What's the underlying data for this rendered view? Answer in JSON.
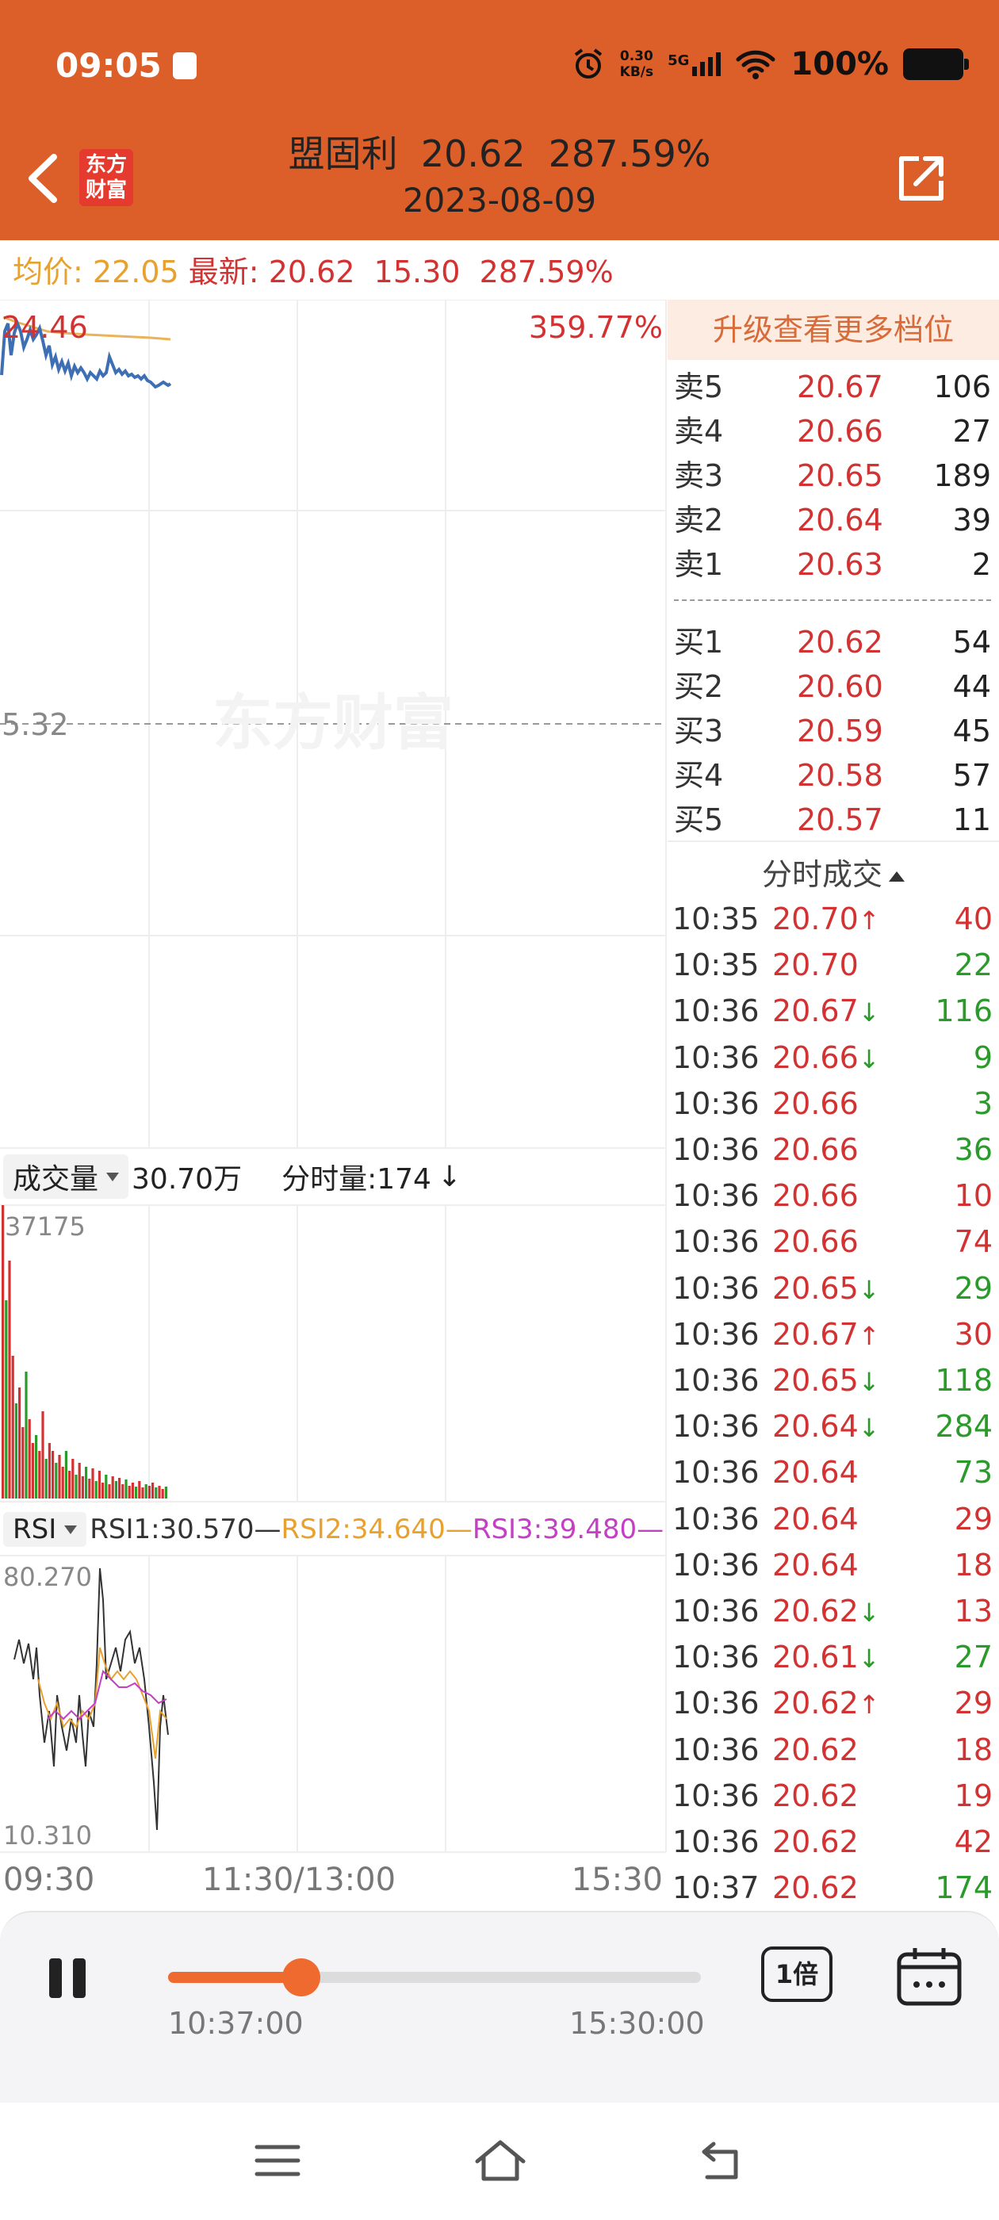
{
  "status_bar": {
    "time": "09:05",
    "net_speed_top": "0.30",
    "net_speed_bottom": "KB/s",
    "network": "5G",
    "battery": "100%"
  },
  "header": {
    "logo_line1": "东方",
    "logo_line2": "财富",
    "stock_name": "盟固利",
    "price": "20.62",
    "change_pct": "287.59%",
    "date": "2023-08-09"
  },
  "info_strip": {
    "avg_label": "均价:",
    "avg_value": "22.05",
    "latest_label": "最新:",
    "latest_value": "20.62",
    "change_value": "15.30",
    "change_pct": "287.59%"
  },
  "price_chart": {
    "top_price_label": "24.46",
    "top_pct_label": "359.77%",
    "mid_price_label": "5.32",
    "watermark": "东方财富"
  },
  "volume_panel": {
    "dropdown_label": "成交量",
    "total": "30.70万",
    "tick_label": "分时量:174",
    "tick_arrow": "↓",
    "max_label": "37175"
  },
  "rsi_panel": {
    "dropdown_label": "RSI",
    "rsi1": "RSI1:30.570—",
    "rsi2": "RSI2:34.640—",
    "rsi3": "RSI3:39.480—",
    "max_label": "80.270",
    "min_label": "10.310",
    "colors": {
      "rsi1": "#333333",
      "rsi2": "#e8a12e",
      "rsi3": "#c43fc4"
    }
  },
  "time_axis": {
    "start": "09:30",
    "mid": "11:30/13:00",
    "end": "15:30"
  },
  "order_book": {
    "upgrade_label": "升级查看更多档位",
    "asks": [
      {
        "label": "卖5",
        "price": "20.67",
        "qty": "106"
      },
      {
        "label": "卖4",
        "price": "20.66",
        "qty": "27"
      },
      {
        "label": "卖3",
        "price": "20.65",
        "qty": "189"
      },
      {
        "label": "卖2",
        "price": "20.64",
        "qty": "39"
      },
      {
        "label": "卖1",
        "price": "20.63",
        "qty": "2"
      }
    ],
    "bids": [
      {
        "label": "买1",
        "price": "20.62",
        "qty": "54"
      },
      {
        "label": "买2",
        "price": "20.60",
        "qty": "44"
      },
      {
        "label": "买3",
        "price": "20.59",
        "qty": "45"
      },
      {
        "label": "买4",
        "price": "20.58",
        "qty": "57"
      },
      {
        "label": "买5",
        "price": "20.57",
        "qty": "11"
      }
    ]
  },
  "ticks": {
    "title": "分时成交",
    "rows": [
      {
        "time": "10:35",
        "price": "20.70",
        "dir": "↑",
        "vol": "40",
        "vol_color": "red"
      },
      {
        "time": "10:35",
        "price": "20.70",
        "dir": "",
        "vol": "22",
        "vol_color": "green"
      },
      {
        "time": "10:36",
        "price": "20.67",
        "dir": "↓",
        "vol": "116",
        "vol_color": "green"
      },
      {
        "time": "10:36",
        "price": "20.66",
        "dir": "↓",
        "vol": "9",
        "vol_color": "green"
      },
      {
        "time": "10:36",
        "price": "20.66",
        "dir": "",
        "vol": "3",
        "vol_color": "green"
      },
      {
        "time": "10:36",
        "price": "20.66",
        "dir": "",
        "vol": "36",
        "vol_color": "green"
      },
      {
        "time": "10:36",
        "price": "20.66",
        "dir": "",
        "vol": "10",
        "vol_color": "red"
      },
      {
        "time": "10:36",
        "price": "20.66",
        "dir": "",
        "vol": "74",
        "vol_color": "red"
      },
      {
        "time": "10:36",
        "price": "20.65",
        "dir": "↓",
        "vol": "29",
        "vol_color": "green"
      },
      {
        "time": "10:36",
        "price": "20.67",
        "dir": "↑",
        "vol": "30",
        "vol_color": "red"
      },
      {
        "time": "10:36",
        "price": "20.65",
        "dir": "↓",
        "vol": "118",
        "vol_color": "green"
      },
      {
        "time": "10:36",
        "price": "20.64",
        "dir": "↓",
        "vol": "284",
        "vol_color": "green"
      },
      {
        "time": "10:36",
        "price": "20.64",
        "dir": "",
        "vol": "73",
        "vol_color": "green"
      },
      {
        "time": "10:36",
        "price": "20.64",
        "dir": "",
        "vol": "29",
        "vol_color": "red"
      },
      {
        "time": "10:36",
        "price": "20.64",
        "dir": "",
        "vol": "18",
        "vol_color": "red"
      },
      {
        "time": "10:36",
        "price": "20.62",
        "dir": "↓",
        "vol": "13",
        "vol_color": "red"
      },
      {
        "time": "10:36",
        "price": "20.61",
        "dir": "↓",
        "vol": "27",
        "vol_color": "green"
      },
      {
        "time": "10:36",
        "price": "20.62",
        "dir": "↑",
        "vol": "29",
        "vol_color": "red"
      },
      {
        "time": "10:36",
        "price": "20.62",
        "dir": "",
        "vol": "18",
        "vol_color": "red"
      },
      {
        "time": "10:36",
        "price": "20.62",
        "dir": "",
        "vol": "19",
        "vol_color": "red"
      },
      {
        "time": "10:36",
        "price": "20.62",
        "dir": "",
        "vol": "42",
        "vol_color": "red"
      },
      {
        "time": "10:37",
        "price": "20.62",
        "dir": "",
        "vol": "174",
        "vol_color": "green"
      }
    ]
  },
  "playback": {
    "progress": 0.25,
    "current_time": "10:37:00",
    "end_time": "15:30:00",
    "speed_label": "1倍"
  }
}
